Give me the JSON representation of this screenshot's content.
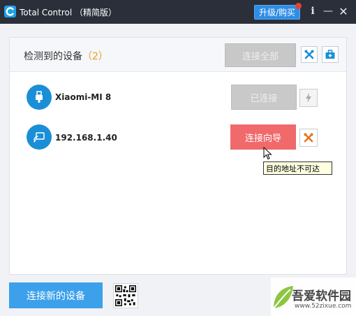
{
  "window": {
    "app_title": "Total Control （精简版）",
    "upgrade_label": "升级/购买",
    "info_glyph": "i",
    "minimize_glyph": "—",
    "close_glyph": "✕",
    "icons": [
      "total-control-logo",
      "info-icon",
      "minimize-icon",
      "close-icon"
    ]
  },
  "header": {
    "detected_label": "检测到的设备",
    "detected_count": "（2）",
    "connect_all_label": "连接全部",
    "icons": [
      "tools-icon",
      "toolkit-icon"
    ]
  },
  "devices": [
    {
      "name": "Xiaomi-MI 8",
      "connection": "usb",
      "icon": "usb-icon",
      "action_label": "已连接",
      "action_state": "disabled",
      "side_icon": "flash-icon"
    },
    {
      "name": "192.168.1.40",
      "connection": "wifi",
      "icon": "wifi-screen-icon",
      "action_label": "连接向导",
      "action_state": "active",
      "side_icon": "tools-icon",
      "tooltip": "目的地址不可达"
    }
  ],
  "footer": {
    "add_device_label": "连接新的设备",
    "qr_icon": "qr-code-icon"
  },
  "watermark": {
    "name": "吾爱软件园",
    "url": "www.52zixue.com"
  },
  "colors": {
    "titlebar": "#2a2f3a",
    "accent_blue": "#3da0ea",
    "device_icon_blue": "#1a8fd8",
    "wizard_red": "#f0696b",
    "count_orange": "#f39c12",
    "notify_red": "#e7412f",
    "disabled_gray": "#c9c9c9"
  }
}
